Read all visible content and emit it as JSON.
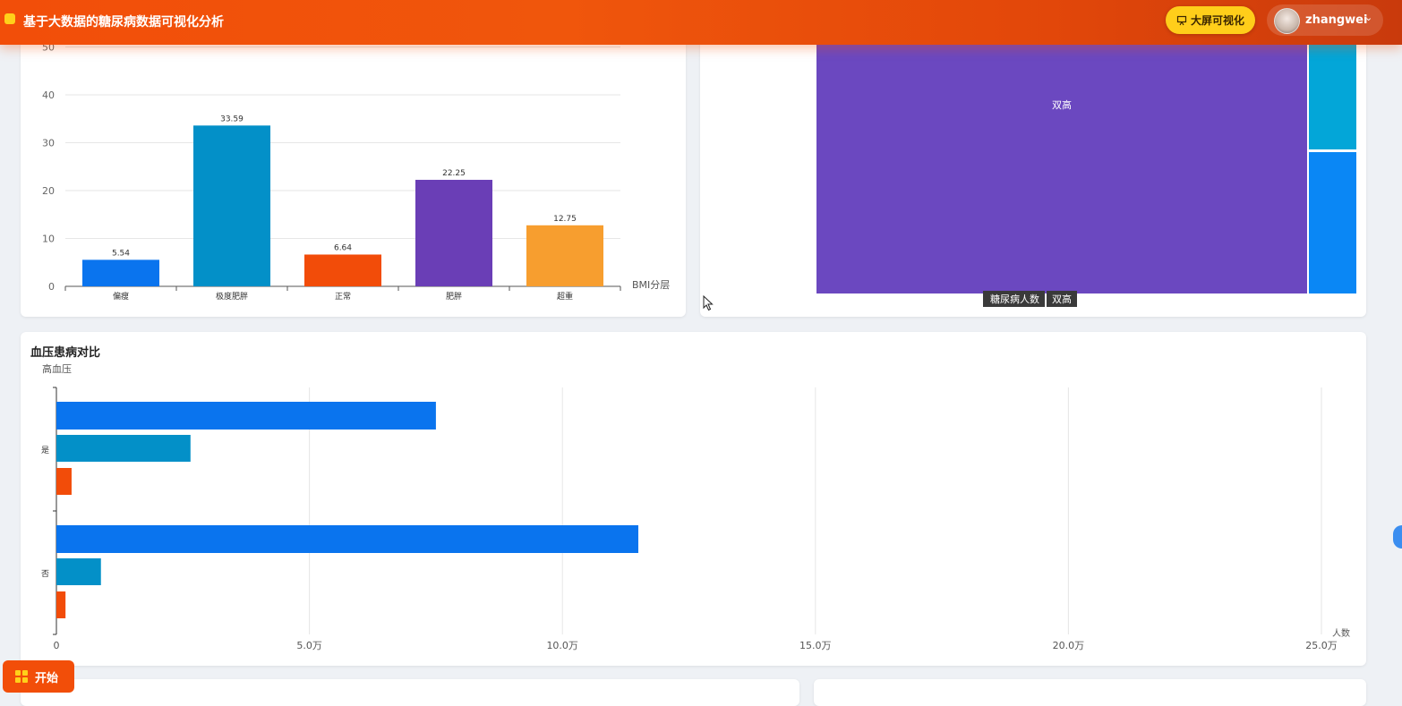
{
  "header": {
    "title": "基于大数据的糖尿病数据可视化分析",
    "bigscreen_label": "大屏可视化",
    "username": "zhangwei"
  },
  "taskbar": {
    "start_label": "开始"
  },
  "colors": {
    "brand": "#f24e09",
    "accent": "#ffce1a",
    "blue": "#0a74ee",
    "teal": "#0390c8",
    "orange_red": "#f24c09",
    "purple": "#6a3eb6",
    "amber": "#f79e2f"
  },
  "bmi_card": {
    "chart_data": {
      "type": "bar",
      "categories": [
        "偏瘦",
        "极度肥胖",
        "正常",
        "肥胖",
        "超重"
      ],
      "values": [
        5.54,
        33.59,
        6.64,
        22.25,
        12.75
      ],
      "value_labels": [
        "5.54",
        "33.59",
        "6.64",
        "22.25",
        "12.75"
      ],
      "xlabel": "BMI分层",
      "ylim": [
        0,
        50
      ],
      "y_ticks": [
        "0",
        "10",
        "20",
        "30",
        "40",
        "50"
      ],
      "bar_colors": [
        "#0a74ee",
        "#0390c8",
        "#f24c09",
        "#6a3eb6",
        "#f79e2f"
      ],
      "grid": true
    }
  },
  "treemap_card": {
    "chart_data": {
      "type": "treemap",
      "visible_blocks": [
        {
          "label": "双高",
          "color": "#6b48c0"
        },
        {
          "label": "",
          "color": "#03a6d8"
        },
        {
          "label": "",
          "color": "#0a87f5"
        }
      ],
      "breadcrumb": [
        "糖尿病人数",
        "双高"
      ]
    }
  },
  "bp_card": {
    "title": "血压患病对比",
    "chart_data": {
      "type": "bar",
      "orientation": "horizontal",
      "ylabel": "高血压",
      "xlabel": "人数",
      "categories": [
        "是",
        "否"
      ],
      "series": [
        {
          "values": [
            75000,
            115000
          ],
          "color": "#0a74ee"
        },
        {
          "values": [
            26500,
            8800
          ],
          "color": "#0390c8"
        },
        {
          "values": [
            3000,
            1800
          ],
          "color": "#f24c09"
        }
      ],
      "xlim": [
        0,
        250000
      ],
      "x_ticks": [
        "0",
        "5.0万",
        "10.0万",
        "15.0万",
        "20.0万",
        "25.0万"
      ],
      "grid": true
    }
  }
}
